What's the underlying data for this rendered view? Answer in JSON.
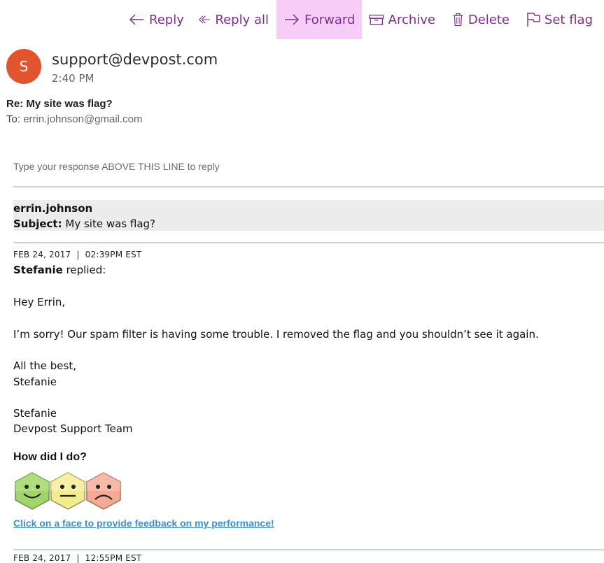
{
  "toolbar": {
    "reply_label": "Reply",
    "reply_all_label": "Reply all",
    "forward_label": "Forward",
    "archive_label": "Archive",
    "delete_label": "Delete",
    "set_flag_label": "Set flag",
    "accent_color": "#7d2f8c",
    "active_bg": "#f6cdf6"
  },
  "header": {
    "avatar_initial": "S",
    "avatar_color": "#e0542e",
    "sender": "support@devpost.com",
    "time": "2:40 PM",
    "subject": "Re: My site was flag?",
    "to_label": "To:",
    "to_address": "errin.johnson@gmail.com"
  },
  "body": {
    "reply_hint": "Type your response ABOVE THIS LINE to reply",
    "quoted_name": "errin.johnson",
    "quoted_subject_label": "Subject:",
    "quoted_subject": "My site was flag?",
    "date_line": "FEB 24, 2017  |  02:39PM EST",
    "replier": "Stefanie",
    "replied_suffix": "replied:",
    "greeting": "Hey Errin,",
    "message": "I’m sorry! Our spam filter is having some trouble. I removed the flag and you shouldn’t see it again.",
    "closing": "All the best,",
    "closing_name": "Stefanie",
    "signature_name": "Stefanie",
    "signature_team": "Devpost Support Team",
    "feedback_heading": "How did I do?",
    "feedback_faces": [
      "happy-face-icon",
      "neutral-face-icon",
      "sad-face-icon"
    ],
    "feedback_link": "Click on a face to provide feedback on my performance!",
    "next_date_line": "FEB 24, 2017  |  12:55PM EST"
  }
}
